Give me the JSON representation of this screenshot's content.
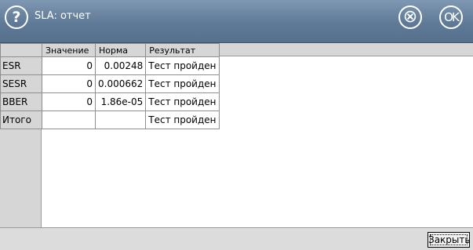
{
  "window": {
    "title": "SLA: отчет",
    "help_label": "?",
    "cancel_label": "⊗",
    "ok_label": "OK"
  },
  "table": {
    "columns": [
      "",
      "Значение",
      "Норма",
      "Результат"
    ],
    "rows": [
      {
        "label": "ESR",
        "value": "0",
        "norm": "0.00248",
        "result": "Тест пройден"
      },
      {
        "label": "SESR",
        "value": "0",
        "norm": "0.000662",
        "result": "Тест пройден"
      },
      {
        "label": "BBER",
        "value": "0",
        "norm": "1.86e-05",
        "result": "Тест пройден"
      },
      {
        "label": "Итого",
        "value": "",
        "norm": "",
        "result": "Тест пройден"
      }
    ]
  },
  "footer": {
    "close_label": "Закрыть"
  }
}
